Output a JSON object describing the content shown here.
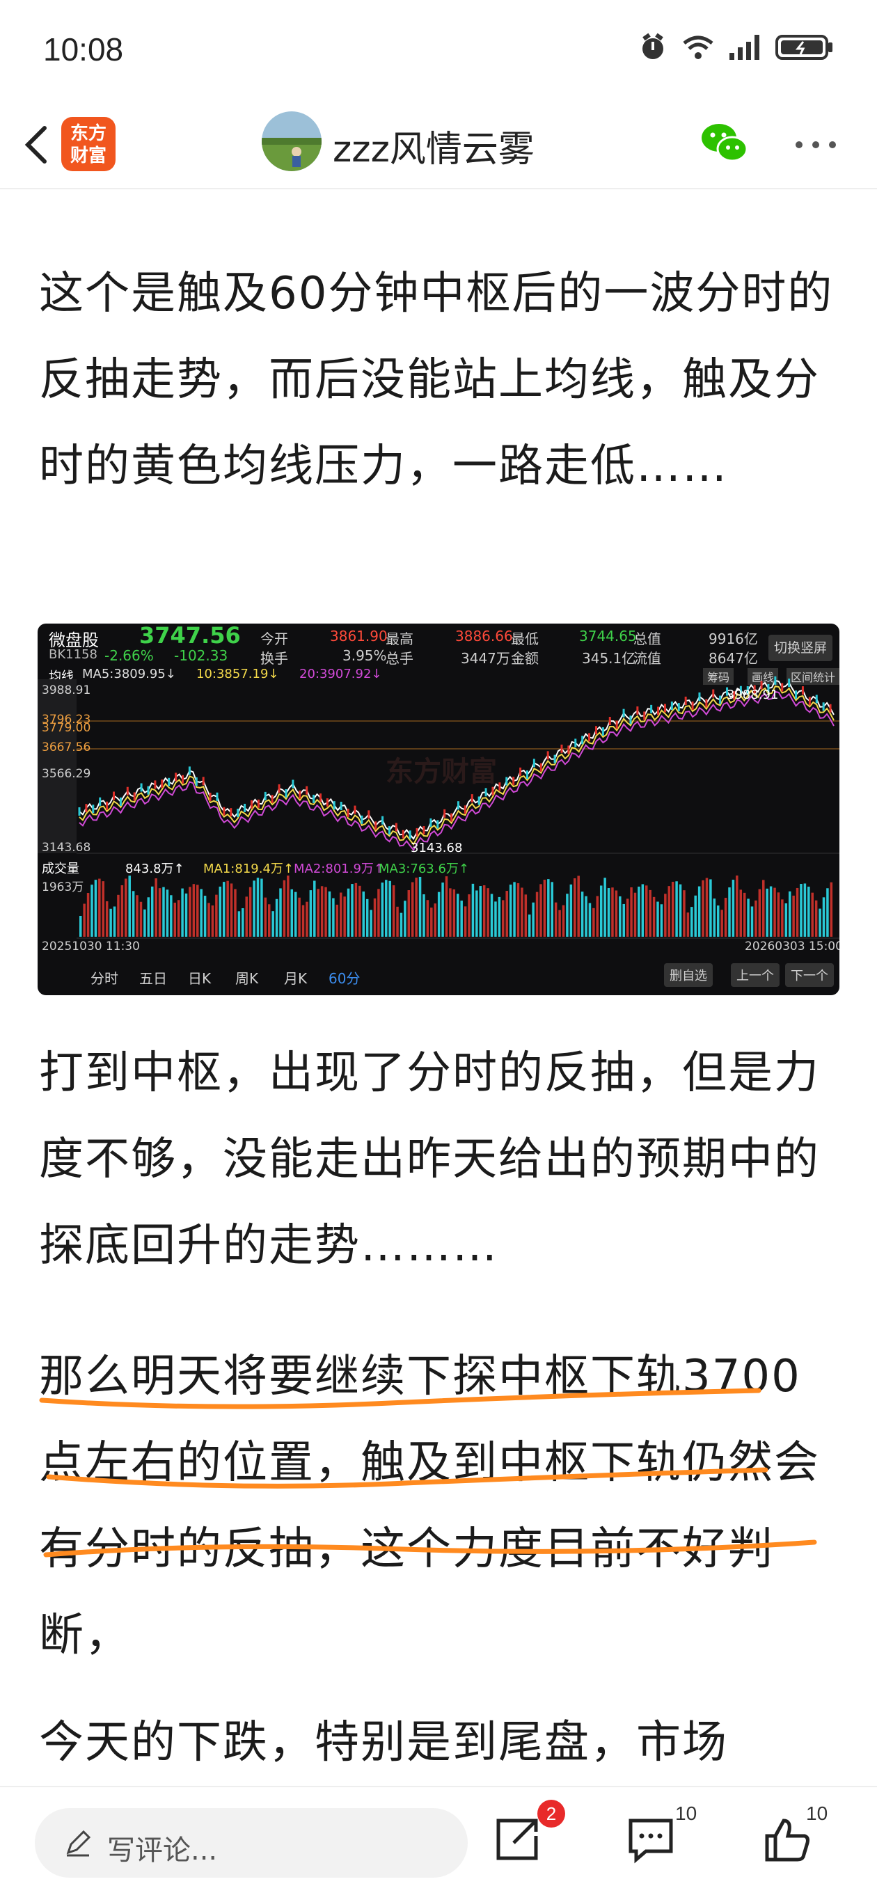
{
  "status": {
    "time": "10:08"
  },
  "header": {
    "logo_text_line1": "东方",
    "logo_text_line2": "财富",
    "author": "zzz风情云雾"
  },
  "article": {
    "p1": "这个是触及60分钟中枢后的一波分时的反抽走势，而后没能站上均线，触及分时的黄色均线压力，一路走低……",
    "p2": " 打到中枢，出现了分时的反抽，但是力度不够，没能走出昨天给出的预期中的探底回升的走势………",
    "p3": "那么明天将要继续下探中枢下轨3700点左右的位置，触及到中枢下轨仍然会有分时的反抽，这个力度目前不好判断，",
    "p4": "今天的下跌，特别是到尾盘，市场"
  },
  "chart": {
    "name": "微盘股",
    "code": "BK1158",
    "price": "3747.56",
    "change_pct": "-2.66%",
    "change_amt": "-102.33",
    "open_label": "今开",
    "open": "3861.90",
    "high_label": "最高",
    "high": "3886.66",
    "low_label": "最低",
    "low": "3744.65",
    "total_value_label": "总值",
    "total_value": "9916亿",
    "turnover_label": "换手",
    "turnover": "3.95%",
    "volume_label": "总手",
    "volume": "3447万",
    "amount_label": "金额",
    "amount": "345.1亿",
    "float_label": "流值",
    "float_value": "8647亿",
    "switch_btn": "切换竖屏",
    "line_label": "均线",
    "ma5": "MA5:3809.95↓",
    "ma10": "10:3857.19↓",
    "ma20": "20:3907.92↓",
    "chip_btn": "筹码",
    "draw_btn": "画线",
    "stats_btn": "区间统计",
    "y_labels": [
      "3988.91",
      "3796.23",
      "3779.00",
      "3667.56",
      "3566.29",
      "3143.68"
    ],
    "peak_label": "3988.91",
    "trough_label": "3143.68",
    "vol_title": "成交量",
    "vol_val": "843.8万↑",
    "vol_ma1": "MA1:819.4万↑",
    "vol_ma2": "MA2:801.9万↑",
    "vol_ma3": "MA3:763.6万↑",
    "vol_max": "1963万",
    "date_start": "2025103​0 11:30",
    "date_end": "20260303 15:00",
    "periods": [
      "分时",
      "五日",
      "日K",
      "周K",
      "月K",
      "60分"
    ],
    "btn_delete": "删自选",
    "btn_prev": "上一个",
    "btn_next": "下一个",
    "watermark": "东方财富"
  },
  "bottom": {
    "comment_placeholder": "写评论...",
    "share_badge": "2",
    "comment_count": "10",
    "like_count": "10"
  },
  "colors": {
    "accent": "#f1561e",
    "up": "#e0302a",
    "down": "#2ac9d6",
    "highlight": "#ff8a1f"
  }
}
